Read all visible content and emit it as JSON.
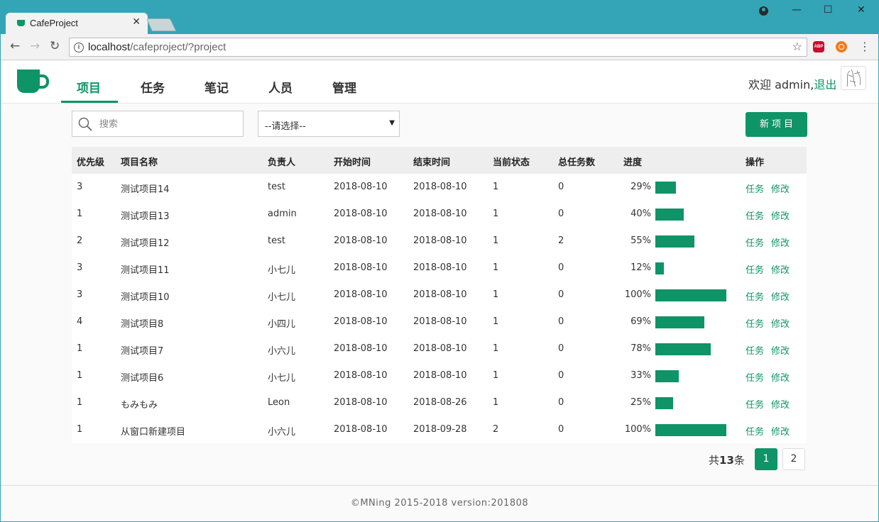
{
  "browser": {
    "tab_title": "CafeProject",
    "tab_close": "✕",
    "url_host": "localhost",
    "url_path": "/cafeproject/?project",
    "back": "←",
    "forward": "→",
    "reload": "↻",
    "star": "☆",
    "abp_label": "ABP",
    "menu": "⋮",
    "minimize": "—",
    "maximize": "☐",
    "close": "✕"
  },
  "nav": {
    "items": [
      {
        "label": "项目"
      },
      {
        "label": "任务"
      },
      {
        "label": "笔记"
      },
      {
        "label": "人员"
      },
      {
        "label": "管理"
      }
    ],
    "active_color": "#0e9467"
  },
  "user": {
    "welcome": "欢迎 admin,",
    "logout": "退出"
  },
  "filters": {
    "search_placeholder": "搜索",
    "select_value": "--请选择--",
    "new_button": "新项目"
  },
  "table": {
    "headers": [
      "优先级",
      "项目名称",
      "负责人",
      "开始时间",
      "结束时间",
      "当前状态",
      "总任务数",
      "进度",
      "操作"
    ],
    "rows": [
      {
        "priority": "3",
        "name": "测试项目14",
        "owner": "test",
        "start": "2018-08-10",
        "end": "2018-08-10",
        "status": "1",
        "tasks": "0",
        "progress": 29,
        "progress_label": "29%"
      },
      {
        "priority": "1",
        "name": "测试项目13",
        "owner": "admin",
        "start": "2018-08-10",
        "end": "2018-08-10",
        "status": "1",
        "tasks": "0",
        "progress": 40,
        "progress_label": "40%"
      },
      {
        "priority": "2",
        "name": "测试项目12",
        "owner": "test",
        "start": "2018-08-10",
        "end": "2018-08-10",
        "status": "1",
        "tasks": "2",
        "progress": 55,
        "progress_label": "55%"
      },
      {
        "priority": "3",
        "name": "测试项目11",
        "owner": "小七儿",
        "start": "2018-08-10",
        "end": "2018-08-10",
        "status": "1",
        "tasks": "0",
        "progress": 12,
        "progress_label": "12%"
      },
      {
        "priority": "3",
        "name": "测试项目10",
        "owner": "小七儿",
        "start": "2018-08-10",
        "end": "2018-08-10",
        "status": "1",
        "tasks": "0",
        "progress": 100,
        "progress_label": "100%"
      },
      {
        "priority": "4",
        "name": "测试项目8",
        "owner": "小四儿",
        "start": "2018-08-10",
        "end": "2018-08-10",
        "status": "1",
        "tasks": "0",
        "progress": 69,
        "progress_label": "69%"
      },
      {
        "priority": "1",
        "name": "测试项目7",
        "owner": "小六儿",
        "start": "2018-08-10",
        "end": "2018-08-10",
        "status": "1",
        "tasks": "0",
        "progress": 78,
        "progress_label": "78%"
      },
      {
        "priority": "1",
        "name": "测试项目6",
        "owner": "小七儿",
        "start": "2018-08-10",
        "end": "2018-08-10",
        "status": "1",
        "tasks": "0",
        "progress": 33,
        "progress_label": "33%"
      },
      {
        "priority": "1",
        "name": "もみもみ",
        "owner": "Leon",
        "start": "2018-08-10",
        "end": "2018-08-26",
        "status": "1",
        "tasks": "0",
        "progress": 25,
        "progress_label": "25%"
      },
      {
        "priority": "1",
        "name": "从窗口新建项目",
        "owner": "小六儿",
        "start": "2018-08-10",
        "end": "2018-09-28",
        "status": "2",
        "tasks": "0",
        "progress": 100,
        "progress_label": "100%"
      }
    ],
    "op_tasks": "任务",
    "op_edit": "修改"
  },
  "pagination": {
    "total_prefix": "共",
    "total_count": "13",
    "total_suffix": "条",
    "pages": [
      "1",
      "2"
    ],
    "current": "1"
  },
  "footer": {
    "text": "©MNing 2015-2018  version:201808"
  },
  "icons": [
    "coffee-cup-logo-icon",
    "search-icon",
    "star-icon",
    "info-icon",
    "user-account-icon"
  ]
}
